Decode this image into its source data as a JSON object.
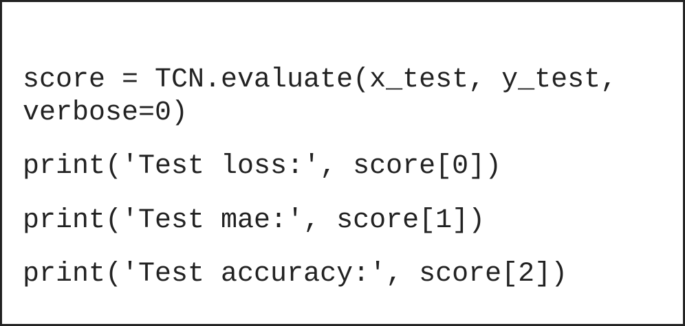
{
  "code": {
    "lines": [
      "score = TCN.evaluate(x_test, y_test,",
      "verbose=0)",
      "print('Test loss:', score[0])",
      "print('Test mae:', score[1])",
      "print('Test accuracy:', score[2])"
    ]
  }
}
